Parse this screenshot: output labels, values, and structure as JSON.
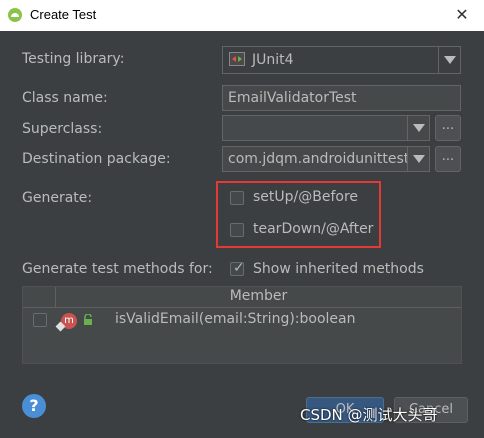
{
  "window": {
    "title": "Create Test",
    "close_symbol": "✕"
  },
  "form": {
    "testing_library": {
      "label": "Testing library:",
      "value": "JUnit4"
    },
    "class_name": {
      "label": "Class name:",
      "value": "EmailValidatorTest"
    },
    "superclass": {
      "label": "Superclass:",
      "value": "",
      "button": "..."
    },
    "destination_package": {
      "label": "Destination package:",
      "value": "com.jdqm.androidunittest",
      "button": "..."
    },
    "generate": {
      "label": "Generate:",
      "options": [
        {
          "label": "setUp/@Before",
          "checked": false
        },
        {
          "label": "tearDown/@After",
          "checked": false
        }
      ]
    },
    "methods_for": {
      "label": "Generate test methods for:",
      "show_inherited_label": "Show inherited methods",
      "show_inherited_checked": true
    }
  },
  "table": {
    "header": "Member",
    "rows": [
      {
        "method": "isValidEmail(email:String):boolean",
        "icon_letter": "m",
        "checked": false
      }
    ]
  },
  "footer": {
    "help": "?",
    "ok": "OK",
    "cancel": "Cancel"
  },
  "watermark": "CSDN @测试大头哥",
  "colors": {
    "background": "#3c3f41",
    "field": "#45494a",
    "highlight": "#e53935",
    "help": "#4a8fd6"
  }
}
